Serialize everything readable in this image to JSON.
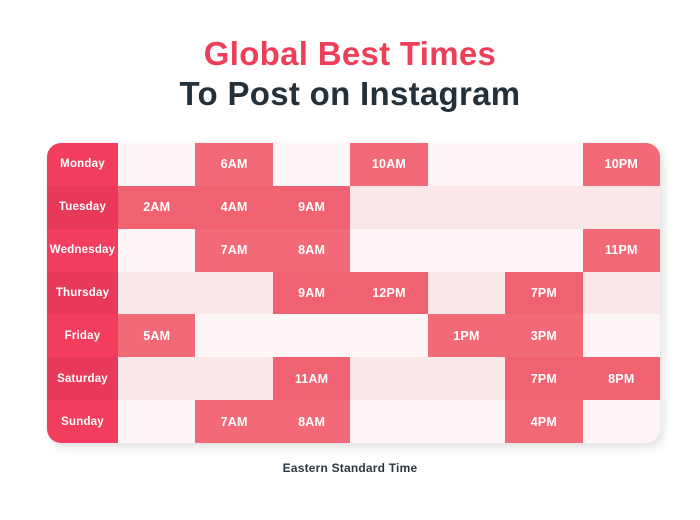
{
  "title": {
    "line1": "Global Best Times",
    "line2": "To Post on Instagram",
    "color_line1": "#ef3f58",
    "color_line2": "#24313a"
  },
  "footer": {
    "note": "Eastern Standard Time"
  },
  "colors": {
    "day_label_light": "#f23d5e",
    "day_label_dark": "#e8395a",
    "slot_filled_light": "#f26a78",
    "slot_filled_dark": "#f06272",
    "slot_empty_light": "#fef5f6",
    "slot_empty_dark": "#fbe6e8"
  },
  "chart_data": {
    "type": "heatmap",
    "title": "Global Best Times To Post on Instagram",
    "xlabel": "",
    "ylabel": "",
    "annotations": [
      "Eastern Standard Time"
    ],
    "legend": [],
    "grid": false,
    "rows": [
      "Monday",
      "Tuesday",
      "Wednesday",
      "Thursday",
      "Friday",
      "Saturday",
      "Sunday"
    ],
    "columns": 7,
    "cells": [
      {
        "day": "Monday",
        "slots": [
          "",
          "6AM",
          "",
          "10AM",
          "",
          "",
          "10PM"
        ]
      },
      {
        "day": "Tuesday",
        "slots": [
          "2AM",
          "4AM",
          "9AM",
          "",
          "",
          "",
          ""
        ]
      },
      {
        "day": "Wednesday",
        "slots": [
          "",
          "7AM",
          "8AM",
          "",
          "",
          "",
          "11PM"
        ]
      },
      {
        "day": "Thursday",
        "slots": [
          "",
          "",
          "9AM",
          "12PM",
          "",
          "7PM",
          ""
        ]
      },
      {
        "day": "Friday",
        "slots": [
          "5AM",
          "",
          "",
          "",
          "1PM",
          "3PM",
          ""
        ]
      },
      {
        "day": "Saturday",
        "slots": [
          "",
          "",
          "11AM",
          "",
          "",
          "7PM",
          "8PM"
        ]
      },
      {
        "day": "Sunday",
        "slots": [
          "",
          "7AM",
          "8AM",
          "",
          "",
          "4PM",
          ""
        ]
      }
    ]
  }
}
